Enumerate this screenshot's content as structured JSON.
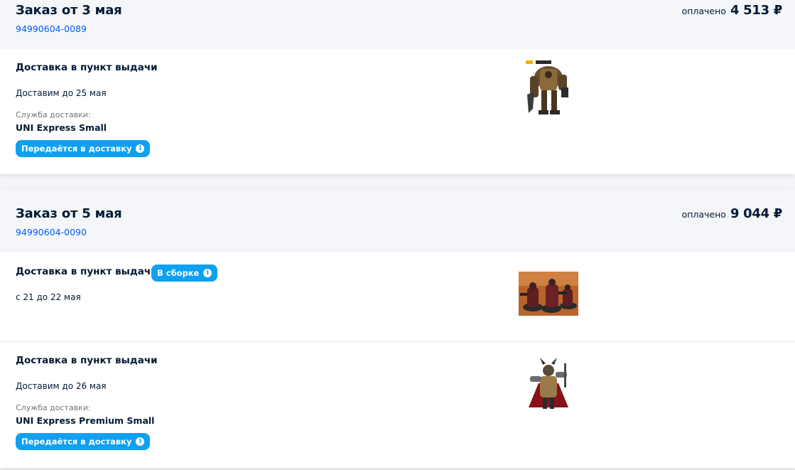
{
  "orders": [
    {
      "title": "Заказ от 3 мая",
      "number": "94990604-0089",
      "paid_label": "оплачено",
      "paid_sum": "4 513 ₽",
      "shipments": [
        {
          "title": "Доставка в пункт выдачи",
          "date": "Доставим до 25 мая",
          "service_label": "Служба доставки:",
          "service_name": "UNI Express Small",
          "status": "Передаётся в доставку",
          "product_image": "dreadnought-figure-image"
        }
      ]
    },
    {
      "title": "Заказ от 5 мая",
      "number": "94990604-0090",
      "paid_label": "оплачено",
      "paid_sum": "9 044 ₽",
      "shipments": [
        {
          "title": "Доставка в пункт выдачи",
          "status": "В сборке",
          "date": "с 21 до 22 мая",
          "product_image": "miniatures-squad-image"
        },
        {
          "title": "Доставка в пункт выдачи",
          "date": "Доставим до 26 мая",
          "service_label": "Служба доставки:",
          "service_name": "UNI Express Premium Small",
          "status": "Передаётся в доставку",
          "product_image": "chaos-warrior-figure-image"
        }
      ]
    }
  ],
  "info_icon": "info-icon",
  "colors": {
    "accent_blue": "#005bff",
    "badge_blue": "#10a0f0",
    "header_bg": "#f4f6f9"
  }
}
